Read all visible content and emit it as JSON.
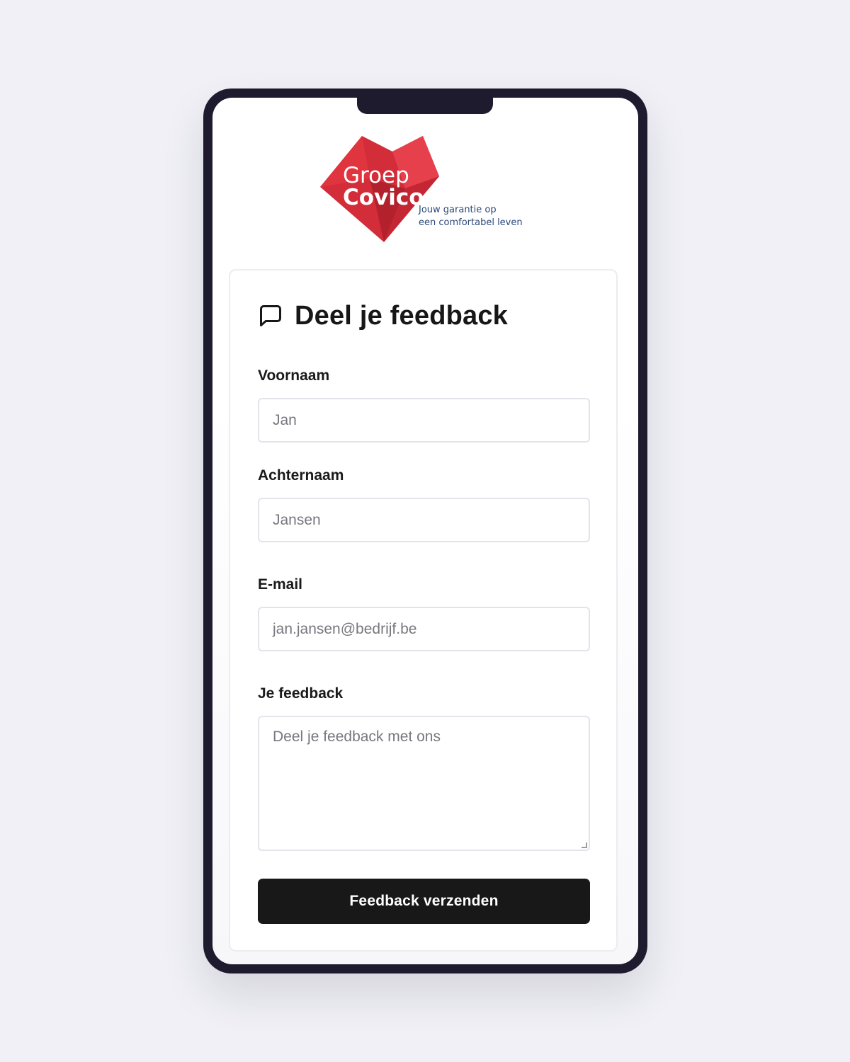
{
  "brand": {
    "name_line1": "Groep",
    "name_line2": "Covico",
    "tagline_line1": "Jouw garantie op",
    "tagline_line2": "een comfortabel leven",
    "primary_color": "#d42d3a",
    "dark_color": "#b3212d",
    "tagline_color": "#2b4a7a"
  },
  "form": {
    "icon": "message-square-icon",
    "title": "Deel je feedback",
    "first_name": {
      "label": "Voornaam",
      "placeholder": "Jan"
    },
    "last_name": {
      "label": "Achternaam",
      "placeholder": "Jansen"
    },
    "email": {
      "label": "E-mail",
      "placeholder": "jan.jansen@bedrijf.be"
    },
    "feedback": {
      "label": "Je feedback",
      "placeholder": "Deel je feedback met ons"
    },
    "submit_label": "Feedback verzenden"
  }
}
